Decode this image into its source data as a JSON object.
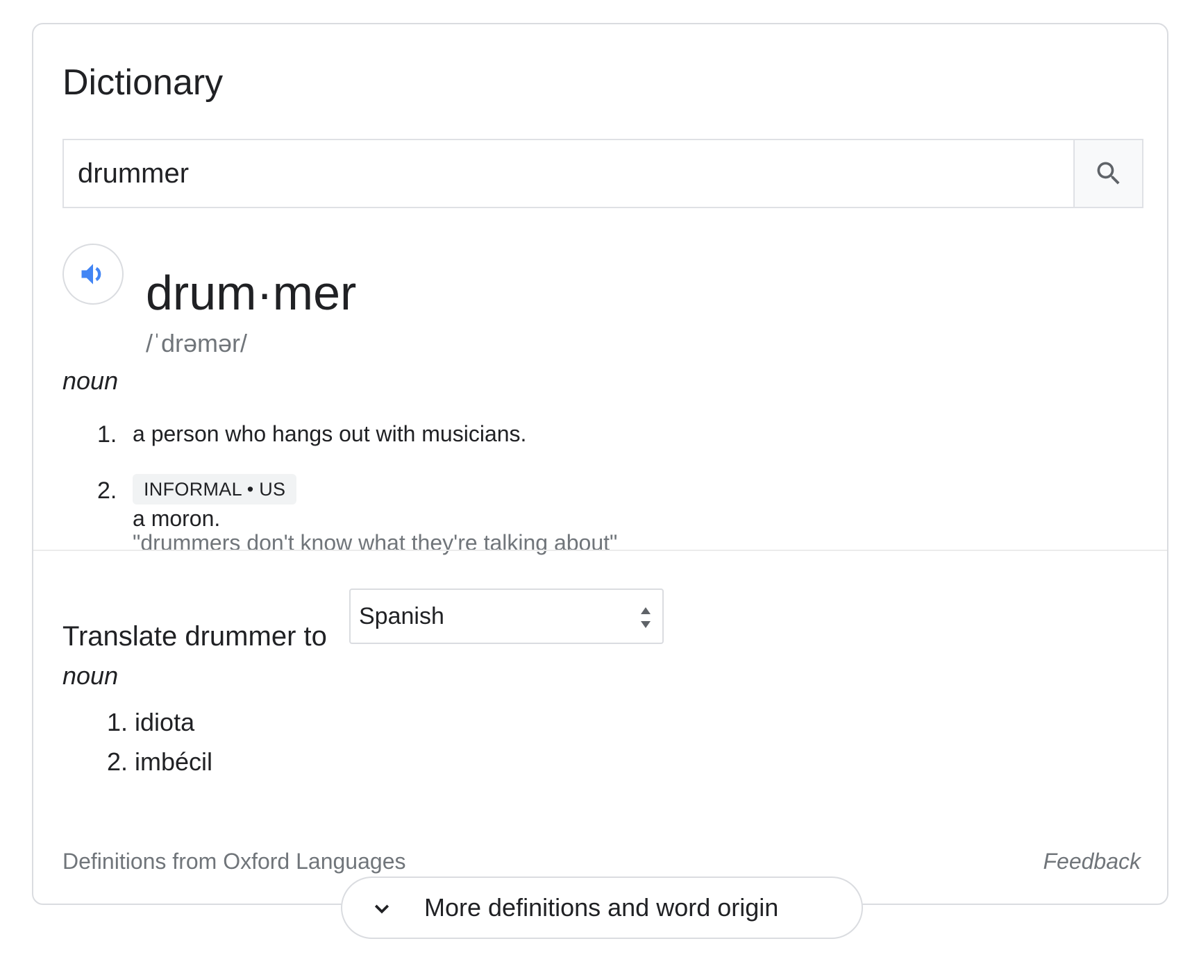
{
  "card": {
    "title": "Dictionary"
  },
  "search": {
    "value": "drummer",
    "icon": "search-icon"
  },
  "entry": {
    "speaker_icon": "speaker-icon",
    "headword": "drum·mer",
    "pronunciation": "/ˈdrəmər/",
    "part_of_speech": "noun",
    "definitions": [
      {
        "number": "1.",
        "text": "a person who hangs out with musicians."
      },
      {
        "number": "2.",
        "label": "INFORMAL • US",
        "text": "a moron.",
        "example": "\"drummers don't know what they're talking about\""
      }
    ]
  },
  "translate": {
    "label": "Translate drummer to",
    "selected_language": "Spanish",
    "part_of_speech": "noun",
    "items": [
      "1. idiota",
      "2. imbécil"
    ]
  },
  "footer": {
    "source": "Definitions from Oxford Languages",
    "feedback": "Feedback"
  },
  "more": {
    "label": "More definitions and word origin",
    "icon": "chevron-down-icon"
  },
  "colors": {
    "accent_blue": "#4285f4",
    "border": "#dadce0",
    "text": "#202124",
    "secondary_text": "#70757a",
    "badge_bg": "#f1f3f4"
  }
}
